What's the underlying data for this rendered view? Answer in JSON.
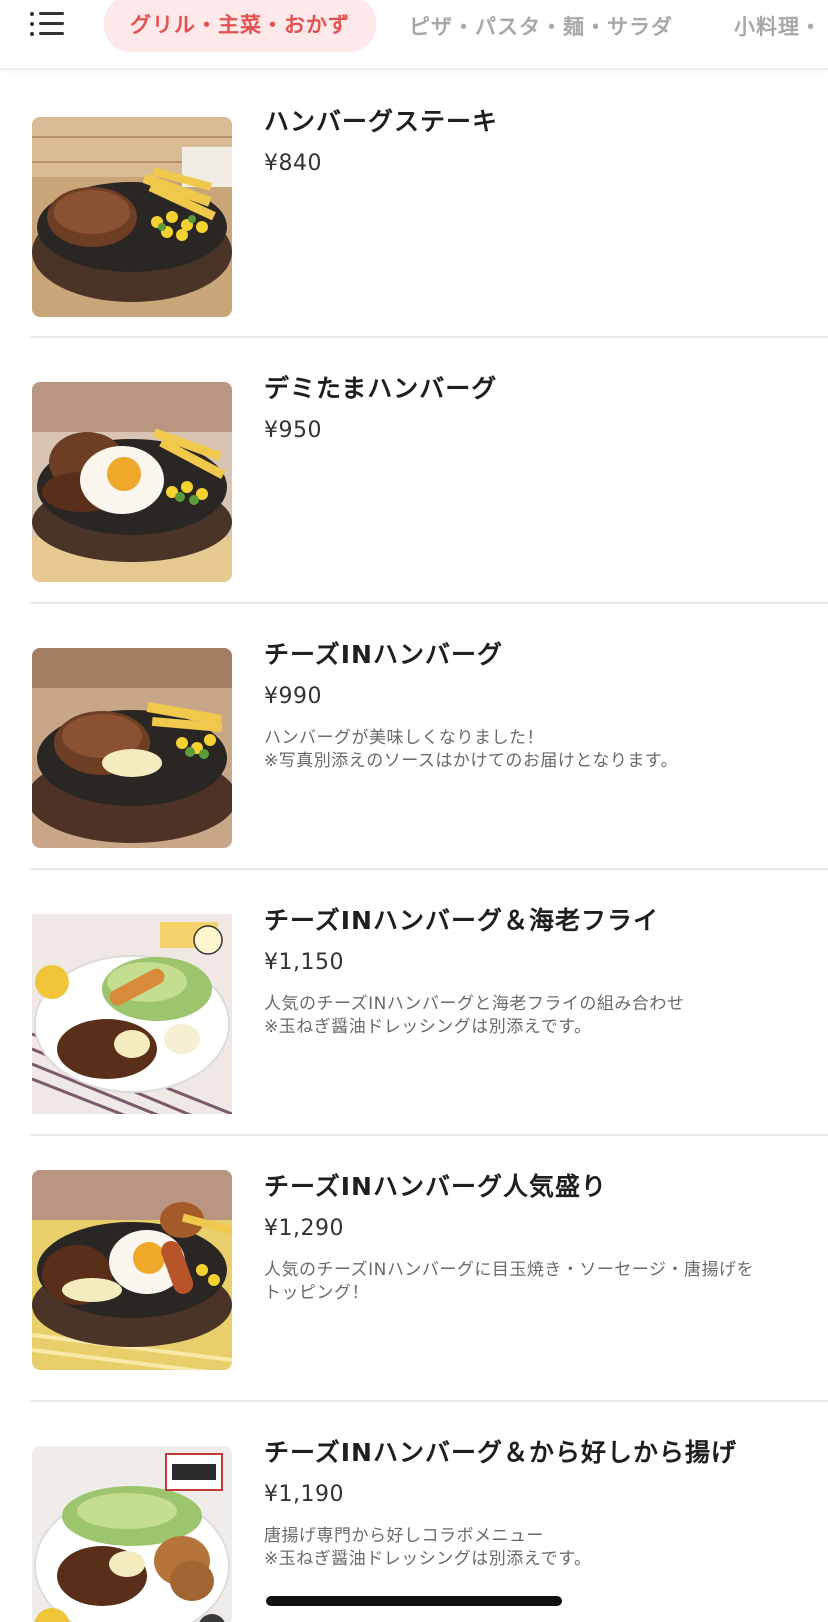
{
  "header": {
    "menu_icon": "list-menu-icon",
    "tabs": [
      {
        "label": "グリル・主菜・おかず",
        "active": true
      },
      {
        "label": "ピザ・パスタ・麺・サラダ",
        "active": false
      },
      {
        "label": "小料理・",
        "active": false
      }
    ],
    "accent_color": "#e25251",
    "active_tab_bg": "#fde9e9"
  },
  "menu_items": [
    {
      "name": "ハンバーグステーキ",
      "price": "¥840",
      "description": ""
    },
    {
      "name": "デミたまハンバーグ",
      "price": "¥950",
      "description": ""
    },
    {
      "name": "チーズINハンバーグ",
      "price": "¥990",
      "description": "ハンバーグが美味しくなりました！\n※写真別添えのソースはかけてのお届けとなります。"
    },
    {
      "name": "チーズINハンバーグ＆海老フライ",
      "price": "¥1,150",
      "description": "人気のチーズINハンバーグと海老フライの組み合わせ\n※玉ねぎ醤油ドレッシングは別添えです。"
    },
    {
      "name": "チーズINハンバーグ人気盛り",
      "price": "¥1,290",
      "description": "人気のチーズINハンバーグに目玉焼き・ソーセージ・唐揚げを\nトッピング！"
    },
    {
      "name": "チーズINハンバーグ＆から好しから揚げ",
      "price": "¥1,190",
      "description": "唐揚げ専門から好しコラボメニュー\n※玉ねぎ醤油ドレッシングは別添えです。"
    }
  ]
}
